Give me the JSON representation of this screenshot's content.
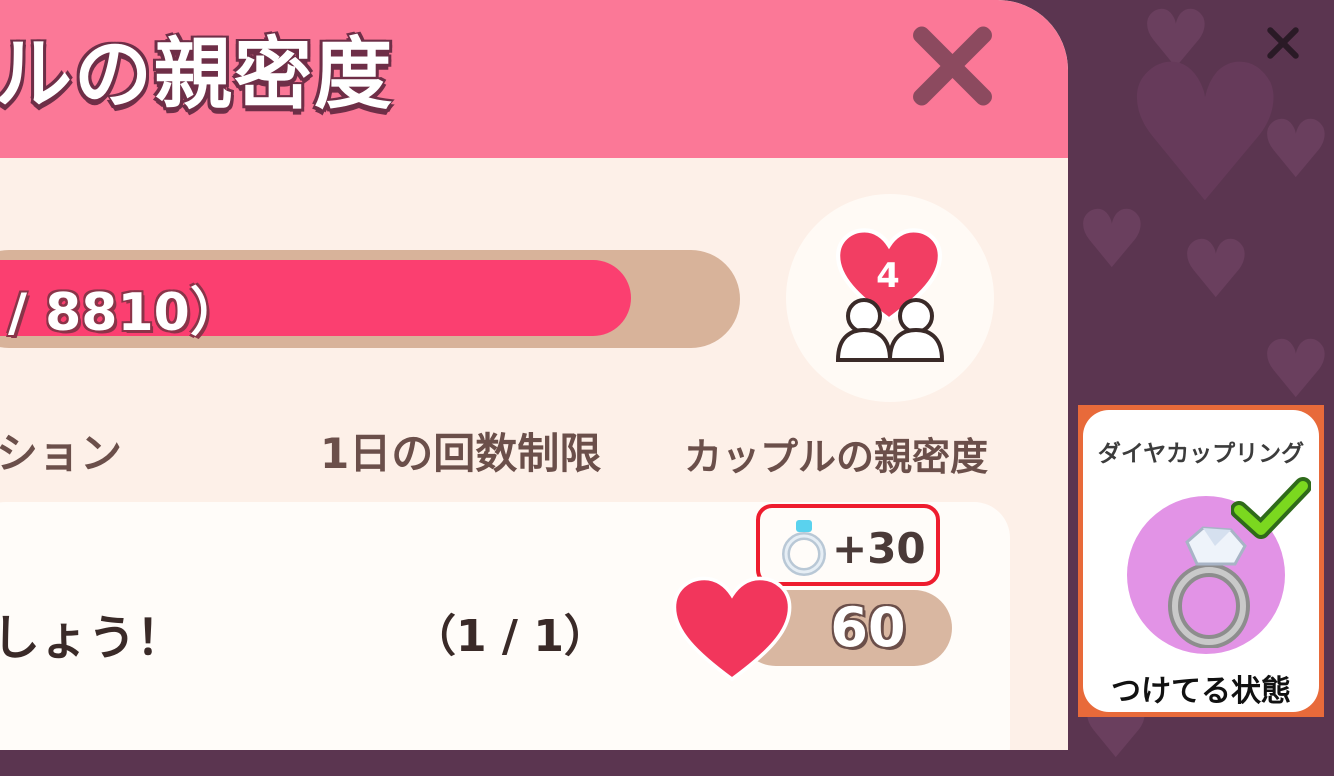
{
  "panel": {
    "title": "ルの親密度",
    "close_icon": "close-icon"
  },
  "progress": {
    "text": "/ 8810）",
    "fill_fraction": 0.86
  },
  "level": {
    "value": "4",
    "icon": "heart-couple-icon"
  },
  "columns": {
    "mission": "ション",
    "limit": "1日の回数制限",
    "intimacy": "カップルの親密度"
  },
  "row": {
    "mission_text": "しょう！",
    "limit_text": "（1 / 1）",
    "bonus_icon": "ring-icon",
    "bonus_text": "+30",
    "points": "60"
  },
  "ad_close_icon": "close-icon",
  "item_card": {
    "name": "ダイヤカップリング",
    "status": "つけてる状態",
    "icon": "diamond-ring-icon",
    "check_icon": "checkmark-icon"
  },
  "colors": {
    "header": "#fb7897",
    "progress_fill": "#fb3f70",
    "background": "#5b3550",
    "highlight_border": "#ee1c2e",
    "card_border": "#e86a3a"
  }
}
